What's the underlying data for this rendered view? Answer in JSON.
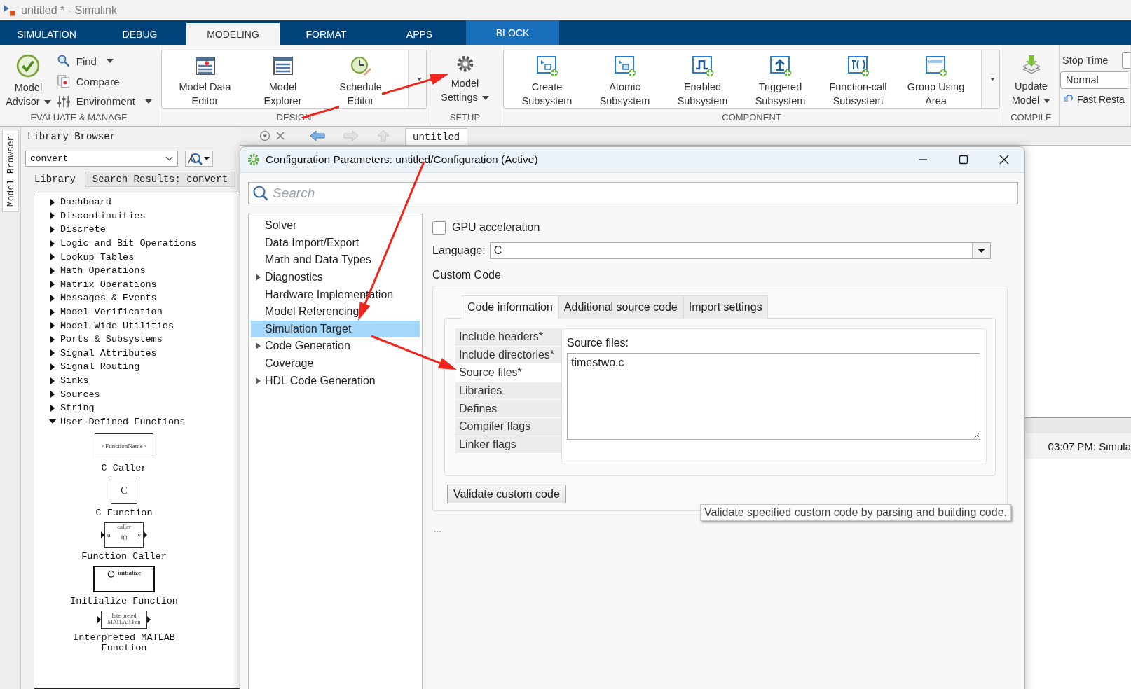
{
  "window": {
    "title": "untitled * - Simulink"
  },
  "ribbon_tabs": [
    {
      "label": "SIMULATION",
      "selected": false,
      "kind": "normal"
    },
    {
      "label": "DEBUG",
      "selected": false,
      "kind": "normal"
    },
    {
      "label": "MODELING",
      "selected": true,
      "kind": "normal"
    },
    {
      "label": "FORMAT",
      "selected": false,
      "kind": "normal"
    },
    {
      "label": "APPS",
      "selected": false,
      "kind": "normal"
    },
    {
      "label": "BLOCK",
      "selected": false,
      "kind": "contextual"
    }
  ],
  "ribbon_sections": [
    {
      "kind": "evaluate",
      "label": "EVALUATE & MANAGE",
      "buttons": [
        {
          "kind": "large",
          "label": "Model\nAdvisor",
          "dropdown": true
        },
        {
          "kind": "small",
          "label": "Find",
          "dropdown": true
        },
        {
          "kind": "small",
          "label": "Compare",
          "dropdown": false
        },
        {
          "kind": "small",
          "label": "Environment",
          "dropdown": true
        }
      ]
    },
    {
      "kind": "gallery",
      "label": "DESIGN",
      "buttons": [
        {
          "kind": "large",
          "label": "Model Data\nEditor",
          "dropdown": false
        },
        {
          "kind": "large",
          "label": "Model\nExplorer",
          "dropdown": false
        },
        {
          "kind": "large",
          "label": "Schedule\nEditor",
          "dropdown": false
        }
      ]
    },
    {
      "kind": "plain",
      "label": "SETUP",
      "buttons": [
        {
          "kind": "large",
          "label": "Model\nSettings",
          "dropdown": true
        }
      ]
    },
    {
      "kind": "gallery",
      "label": "COMPONENT",
      "buttons": [
        {
          "kind": "large",
          "label": "Create\nSubsystem",
          "dropdown": false
        },
        {
          "kind": "large",
          "label": "Atomic\nSubsystem",
          "dropdown": false
        },
        {
          "kind": "large",
          "label": "Enabled\nSubsystem",
          "dropdown": false
        },
        {
          "kind": "large",
          "label": "Triggered\nSubsystem",
          "dropdown": false
        },
        {
          "kind": "large",
          "label": "Function-call\nSubsystem",
          "dropdown": false
        },
        {
          "kind": "large",
          "label": "Group Using\nArea",
          "dropdown": false
        }
      ]
    },
    {
      "kind": "plain",
      "label": "COMPILE",
      "buttons": [
        {
          "kind": "large",
          "label": "Update\nModel",
          "dropdown": true
        }
      ]
    },
    {
      "kind": "fields",
      "stop_time_label": "Stop Time",
      "mode": "Normal",
      "fast_restart": "Fast Resta"
    }
  ],
  "library_browser": {
    "side_tab": "Model Browser",
    "title": "Library Browser",
    "search": "convert",
    "tabs": [
      {
        "label": "Library",
        "selected": true
      },
      {
        "label": "Search Results: convert",
        "selected": false
      }
    ],
    "tree": [
      {
        "label": "Dashboard",
        "expanded": false
      },
      {
        "label": "Discontinuities",
        "expanded": false
      },
      {
        "label": "Discrete",
        "expanded": false
      },
      {
        "label": "Logic and Bit Operations",
        "expanded": false
      },
      {
        "label": "Lookup Tables",
        "expanded": false
      },
      {
        "label": "Math Operations",
        "expanded": false
      },
      {
        "label": "Matrix Operations",
        "expanded": false
      },
      {
        "label": "Messages & Events",
        "expanded": false
      },
      {
        "label": "Model Verification",
        "expanded": false
      },
      {
        "label": "Model-Wide Utilities",
        "expanded": false
      },
      {
        "label": "Ports & Subsystems",
        "expanded": false
      },
      {
        "label": "Signal Attributes",
        "expanded": false
      },
      {
        "label": "Signal Routing",
        "expanded": false
      },
      {
        "label": "Sinks",
        "expanded": false
      },
      {
        "label": "Sources",
        "expanded": false
      },
      {
        "label": "String",
        "expanded": false
      },
      {
        "label": "User-Defined Functions",
        "expanded": true,
        "children": [
          {
            "label": "C Caller",
            "kind": "c-caller",
            "block_text": [
              "<FunctionName>"
            ]
          },
          {
            "label": "C Function",
            "kind": "c-function",
            "block_text": [
              "C"
            ]
          },
          {
            "label": "Function Caller",
            "kind": "function-caller",
            "block_text": [
              "caller",
              "u",
              "f()",
              "y"
            ]
          },
          {
            "label": "Initialize Function",
            "kind": "initialize",
            "block_text": [
              "initialize"
            ]
          },
          {
            "label": "Interpreted MATLAB\nFunction",
            "kind": "interpreted",
            "block_text": [
              "Interpreted\nMATLAB Fcn"
            ]
          }
        ]
      }
    ]
  },
  "canvas": {
    "tab": "untitled",
    "status": "03:07 PM: Simula"
  },
  "dialog": {
    "title": "Configuration Parameters: untitled/Configuration (Active)",
    "search_placeholder": "Search",
    "nav": [
      {
        "label": "Solver",
        "selected": false,
        "expandable": false
      },
      {
        "label": "Data Import/Export",
        "selected": false,
        "expandable": false
      },
      {
        "label": "Math and Data Types",
        "selected": false,
        "expandable": false
      },
      {
        "label": "Diagnostics",
        "selected": false,
        "expandable": true
      },
      {
        "label": "Hardware Implementation",
        "selected": false,
        "expandable": false
      },
      {
        "label": "Model Referencing",
        "selected": false,
        "expandable": false
      },
      {
        "label": "Simulation Target",
        "selected": true,
        "expandable": false
      },
      {
        "label": "Code Generation",
        "selected": false,
        "expandable": true
      },
      {
        "label": "Coverage",
        "selected": false,
        "expandable": false
      },
      {
        "label": "HDL Code Generation",
        "selected": false,
        "expandable": true
      }
    ],
    "gpu": {
      "label": "GPU acceleration",
      "checked": false
    },
    "language": {
      "label": "Language:",
      "value": "C"
    },
    "custom_code": {
      "title": "Custom Code",
      "tabs": [
        {
          "label": "Code information",
          "selected": true
        },
        {
          "label": "Additional source code",
          "selected": false
        },
        {
          "label": "Import settings",
          "selected": false
        }
      ],
      "categories": [
        {
          "label": "Include headers*",
          "selected": false
        },
        {
          "label": "Include directories*",
          "selected": false
        },
        {
          "label": "Source files*",
          "selected": true
        },
        {
          "label": "Libraries",
          "selected": false
        },
        {
          "label": "Defines",
          "selected": false
        },
        {
          "label": "Compiler flags",
          "selected": false
        },
        {
          "label": "Linker flags",
          "selected": false
        }
      ],
      "field_label": "Source files:",
      "field_value": "timestwo.c"
    },
    "validate_button": "Validate custom code",
    "tooltip": "Validate specified custom code by parsing and building code.",
    "ellipsis": "..."
  }
}
